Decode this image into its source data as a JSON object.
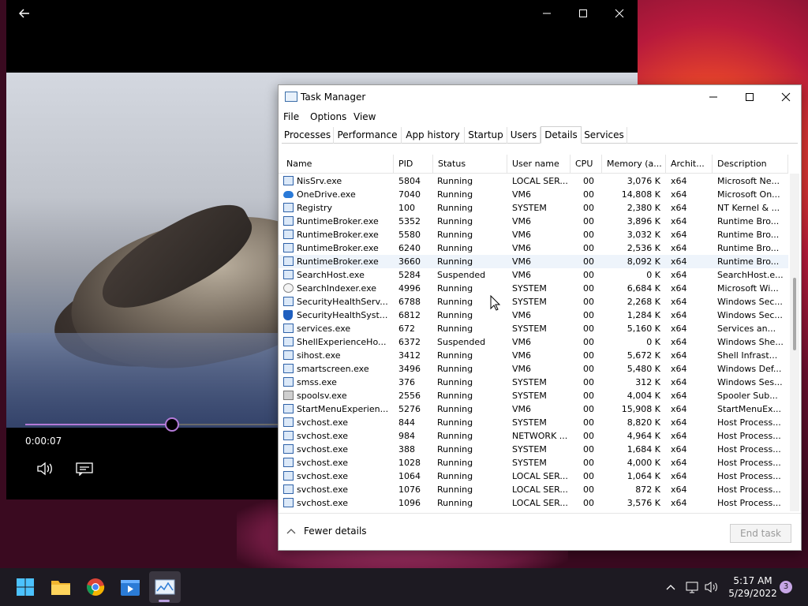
{
  "player": {
    "time": "0:00:07",
    "progress_fraction": 0.58
  },
  "taskmanager": {
    "title": "Task Manager",
    "menu": [
      "File",
      "Options",
      "View"
    ],
    "tabs": [
      "Processes",
      "Performance",
      "App history",
      "Startup",
      "Users",
      "Details",
      "Services"
    ],
    "active_tab": "Details",
    "columns": [
      "Name",
      "PID",
      "Status",
      "User name",
      "CPU",
      "Memory (a...",
      "Archit...",
      "Description"
    ],
    "rows": [
      {
        "icon": "app",
        "name": "NisSrv.exe",
        "pid": "5804",
        "status": "Running",
        "user": "LOCAL SER...",
        "cpu": "00",
        "mem": "3,076 K",
        "arch": "x64",
        "desc": "Microsoft Ne..."
      },
      {
        "icon": "cloud",
        "name": "OneDrive.exe",
        "pid": "7040",
        "status": "Running",
        "user": "VM6",
        "cpu": "00",
        "mem": "14,808 K",
        "arch": "x64",
        "desc": "Microsoft On..."
      },
      {
        "icon": "app",
        "name": "Registry",
        "pid": "100",
        "status": "Running",
        "user": "SYSTEM",
        "cpu": "00",
        "mem": "2,380 K",
        "arch": "x64",
        "desc": "NT Kernel & ..."
      },
      {
        "icon": "app",
        "name": "RuntimeBroker.exe",
        "pid": "5352",
        "status": "Running",
        "user": "VM6",
        "cpu": "00",
        "mem": "3,896 K",
        "arch": "x64",
        "desc": "Runtime Bro..."
      },
      {
        "icon": "app",
        "name": "RuntimeBroker.exe",
        "pid": "5580",
        "status": "Running",
        "user": "VM6",
        "cpu": "00",
        "mem": "3,032 K",
        "arch": "x64",
        "desc": "Runtime Bro..."
      },
      {
        "icon": "app",
        "name": "RuntimeBroker.exe",
        "pid": "6240",
        "status": "Running",
        "user": "VM6",
        "cpu": "00",
        "mem": "2,536 K",
        "arch": "x64",
        "desc": "Runtime Bro..."
      },
      {
        "icon": "app",
        "name": "RuntimeBroker.exe",
        "pid": "3660",
        "status": "Running",
        "user": "VM6",
        "cpu": "00",
        "mem": "8,092 K",
        "arch": "x64",
        "desc": "Runtime Bro...",
        "selected": true
      },
      {
        "icon": "app",
        "name": "SearchHost.exe",
        "pid": "5284",
        "status": "Suspended",
        "user": "VM6",
        "cpu": "00",
        "mem": "0 K",
        "arch": "x64",
        "desc": "SearchHost.e..."
      },
      {
        "icon": "search",
        "name": "SearchIndexer.exe",
        "pid": "4996",
        "status": "Running",
        "user": "SYSTEM",
        "cpu": "00",
        "mem": "6,684 K",
        "arch": "x64",
        "desc": "Microsoft Wi..."
      },
      {
        "icon": "app",
        "name": "SecurityHealthServ...",
        "pid": "6788",
        "status": "Running",
        "user": "SYSTEM",
        "cpu": "00",
        "mem": "2,268 K",
        "arch": "x64",
        "desc": "Windows Sec..."
      },
      {
        "icon": "shield",
        "name": "SecurityHealthSyst...",
        "pid": "6812",
        "status": "Running",
        "user": "VM6",
        "cpu": "00",
        "mem": "1,284 K",
        "arch": "x64",
        "desc": "Windows Sec..."
      },
      {
        "icon": "app",
        "name": "services.exe",
        "pid": "672",
        "status": "Running",
        "user": "SYSTEM",
        "cpu": "00",
        "mem": "5,160 K",
        "arch": "x64",
        "desc": "Services an..."
      },
      {
        "icon": "app",
        "name": "ShellExperienceHo...",
        "pid": "6372",
        "status": "Suspended",
        "user": "VM6",
        "cpu": "00",
        "mem": "0 K",
        "arch": "x64",
        "desc": "Windows She..."
      },
      {
        "icon": "app",
        "name": "sihost.exe",
        "pid": "3412",
        "status": "Running",
        "user": "VM6",
        "cpu": "00",
        "mem": "5,672 K",
        "arch": "x64",
        "desc": "Shell Infrast..."
      },
      {
        "icon": "app",
        "name": "smartscreen.exe",
        "pid": "3496",
        "status": "Running",
        "user": "VM6",
        "cpu": "00",
        "mem": "5,480 K",
        "arch": "x64",
        "desc": "Windows Def..."
      },
      {
        "icon": "app",
        "name": "smss.exe",
        "pid": "376",
        "status": "Running",
        "user": "SYSTEM",
        "cpu": "00",
        "mem": "312 K",
        "arch": "x64",
        "desc": "Windows Ses..."
      },
      {
        "icon": "printer",
        "name": "spoolsv.exe",
        "pid": "2556",
        "status": "Running",
        "user": "SYSTEM",
        "cpu": "00",
        "mem": "4,004 K",
        "arch": "x64",
        "desc": "Spooler Sub..."
      },
      {
        "icon": "app",
        "name": "StartMenuExperien...",
        "pid": "5276",
        "status": "Running",
        "user": "VM6",
        "cpu": "00",
        "mem": "15,908 K",
        "arch": "x64",
        "desc": "StartMenuEx..."
      },
      {
        "icon": "app",
        "name": "svchost.exe",
        "pid": "844",
        "status": "Running",
        "user": "SYSTEM",
        "cpu": "00",
        "mem": "8,820 K",
        "arch": "x64",
        "desc": "Host Process..."
      },
      {
        "icon": "app",
        "name": "svchost.exe",
        "pid": "984",
        "status": "Running",
        "user": "NETWORK ...",
        "cpu": "00",
        "mem": "4,964 K",
        "arch": "x64",
        "desc": "Host Process..."
      },
      {
        "icon": "app",
        "name": "svchost.exe",
        "pid": "388",
        "status": "Running",
        "user": "SYSTEM",
        "cpu": "00",
        "mem": "1,684 K",
        "arch": "x64",
        "desc": "Host Process..."
      },
      {
        "icon": "app",
        "name": "svchost.exe",
        "pid": "1028",
        "status": "Running",
        "user": "SYSTEM",
        "cpu": "00",
        "mem": "4,000 K",
        "arch": "x64",
        "desc": "Host Process..."
      },
      {
        "icon": "app",
        "name": "svchost.exe",
        "pid": "1064",
        "status": "Running",
        "user": "LOCAL SER...",
        "cpu": "00",
        "mem": "1,064 K",
        "arch": "x64",
        "desc": "Host Process..."
      },
      {
        "icon": "app",
        "name": "svchost.exe",
        "pid": "1076",
        "status": "Running",
        "user": "LOCAL SER...",
        "cpu": "00",
        "mem": "872 K",
        "arch": "x64",
        "desc": "Host Process..."
      },
      {
        "icon": "app",
        "name": "svchost.exe",
        "pid": "1096",
        "status": "Running",
        "user": "LOCAL SER...",
        "cpu": "00",
        "mem": "3,576 K",
        "arch": "x64",
        "desc": "Host Process..."
      }
    ],
    "fewer_details": "Fewer details",
    "end_task": "End task"
  },
  "taskbar": {
    "time": "5:17 AM",
    "date": "5/29/2022",
    "notification_count": "3",
    "apps": [
      "start-icon",
      "file-explorer-icon",
      "chrome-icon",
      "media-player-icon",
      "task-manager-icon"
    ]
  }
}
